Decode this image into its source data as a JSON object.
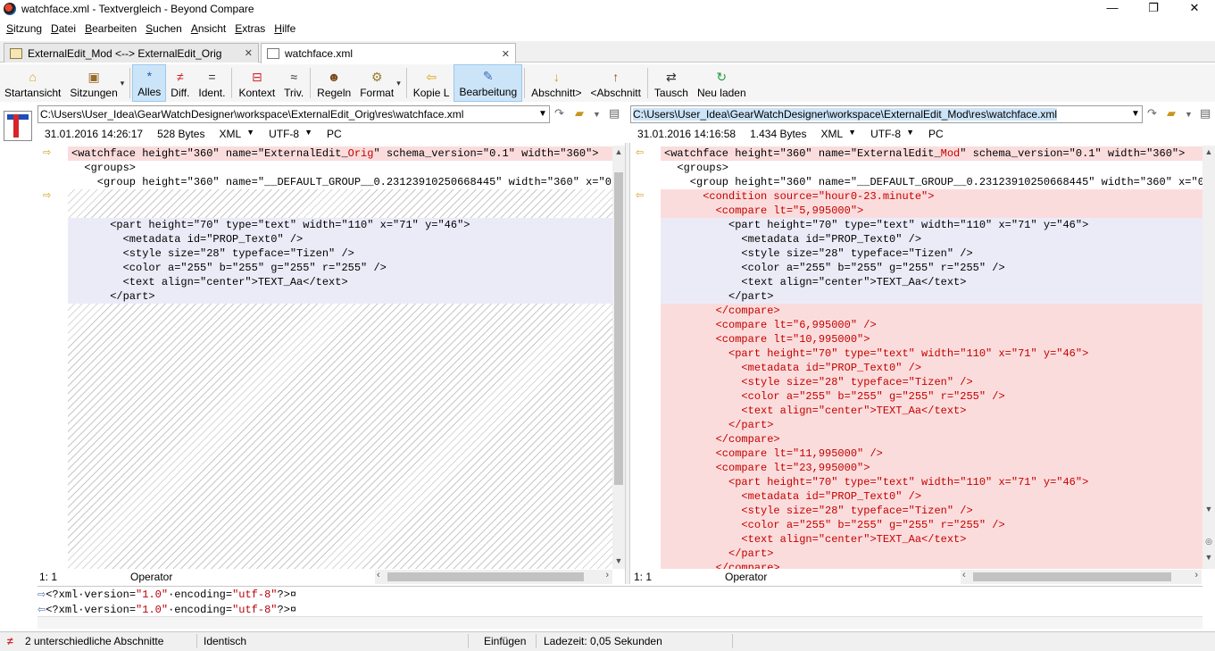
{
  "window": {
    "title": "watchface.xml - Textvergleich - Beyond Compare",
    "controls": [
      "—",
      "❐",
      "✕"
    ]
  },
  "menu": [
    "Sitzung",
    "Datei",
    "Bearbeiten",
    "Suchen",
    "Ansicht",
    "Extras",
    "Hilfe"
  ],
  "tabs": [
    {
      "label": "ExternalEdit_Mod <--> ExternalEdit_Orig",
      "close": "✕"
    },
    {
      "label": "watchface.xml",
      "close": "✕"
    }
  ],
  "toolbar": {
    "startansicht": "Startansicht",
    "sitzungen": "Sitzungen",
    "alles": "Alles",
    "diff": "Diff.",
    "ident": "Ident.",
    "kontext": "Kontext",
    "triv": "Triv.",
    "regeln": "Regeln",
    "format": "Format",
    "kopie_l": "Kopie L",
    "bearbeitung": "Bearbeitung",
    "abschnitt_next": "Abschnitt>",
    "abschnitt_prev": "<Abschnitt",
    "tausch": "Tausch",
    "neu_laden": "Neu laden",
    "dropdown": "▾"
  },
  "left": {
    "path": "C:\\Users\\User_Idea\\GearWatchDesigner\\workspace\\ExternalEdit_Orig\\res\\watchface.xml",
    "date": "31.01.2016 14:26:17",
    "size": "528 Bytes",
    "format": "XML",
    "encoding": "UTF-8",
    "lineend": "PC",
    "pos": "1: 1",
    "mode": "Operator",
    "lines": {
      "l1_pre": "<watchface height=\"360\" name=\"ExternalEdit_",
      "l1_hl": "Orig",
      "l1_post": "\" schema_version=\"0.1\" width=\"360\">",
      "l2": "  <groups>",
      "l3": "    <group height=\"360\" name=\"__DEFAULT_GROUP__0.23123910250668445\" width=\"360\" x=\"0\" y",
      "l6": "      <part height=\"70\" type=\"text\" width=\"110\" x=\"71\" y=\"46\">",
      "l7": "        <metadata id=\"PROP_Text0\" />",
      "l8": "        <style size=\"28\" typeface=\"Tizen\" />",
      "l9": "        <color a=\"255\" b=\"255\" g=\"255\" r=\"255\" />",
      "l10": "        <text align=\"center\">TEXT_Aa</text>",
      "l11": "      </part>"
    }
  },
  "right": {
    "path": "C:\\Users\\User_Idea\\GearWatchDesigner\\workspace\\ExternalEdit_Mod\\res\\watchface.xml",
    "date": "31.01.2016 14:16:58",
    "size": "1.434 Bytes",
    "format": "XML",
    "encoding": "UTF-8",
    "lineend": "PC",
    "pos": "1: 1",
    "mode": "Operator",
    "lines": {
      "l1_pre": "<watchface height=\"360\" name=\"ExternalEdit_",
      "l1_hl": "Mod",
      "l1_post": "\" schema_version=\"0.1\" width=\"360\">",
      "l2": "  <groups>",
      "l3": "    <group height=\"360\" name=\"__DEFAULT_GROUP__0.23123910250668445\" width=\"360\" x=\"0\" y",
      "l4": "      <condition source=\"hour0-23.minute\">",
      "l5": "        <compare lt=\"5,995000\">",
      "l6": "          <part height=\"70\" type=\"text\" width=\"110\" x=\"71\" y=\"46\">",
      "l7": "            <metadata id=\"PROP_Text0\" />",
      "l8": "            <style size=\"28\" typeface=\"Tizen\" />",
      "l9": "            <color a=\"255\" b=\"255\" g=\"255\" r=\"255\" />",
      "l10": "            <text align=\"center\">TEXT_Aa</text>",
      "l11": "          </part>",
      "l12": "        </compare>",
      "l13": "        <compare lt=\"6,995000\" />",
      "l14": "        <compare lt=\"10,995000\">",
      "l15": "          <part height=\"70\" type=\"text\" width=\"110\" x=\"71\" y=\"46\">",
      "l16": "            <metadata id=\"PROP_Text0\" />",
      "l17": "            <style size=\"28\" typeface=\"Tizen\" />",
      "l18": "            <color a=\"255\" b=\"255\" g=\"255\" r=\"255\" />",
      "l19": "            <text align=\"center\">TEXT_Aa</text>",
      "l20": "          </part>",
      "l21": "        </compare>",
      "l22": "        <compare lt=\"11,995000\" />",
      "l23": "        <compare lt=\"23,995000\">",
      "l24": "          <part height=\"70\" type=\"text\" width=\"110\" x=\"71\" y=\"46\">",
      "l25": "            <metadata id=\"PROP_Text0\" />",
      "l26": "            <style size=\"28\" typeface=\"Tizen\" />",
      "l27": "            <color a=\"255\" b=\"255\" g=\"255\" r=\"255\" />",
      "l28": "            <text align=\"center\">TEXT_Aa</text>",
      "l29": "          </part>",
      "l30": "        </compare>"
    }
  },
  "linecompare": {
    "prefix": "<?xml·version=",
    "v1": "\"1.0\"",
    "mid": "·encoding=",
    "v2": "\"utf-8\"",
    "suffix": "?>¤"
  },
  "status": {
    "diff_count": "2 unterschiedliche Abschnitte",
    "identical": "Identisch",
    "insert_mode": "Einfügen",
    "load_time": "Ladezeit: 0,05 Sekunden"
  },
  "colors": {
    "diff_bg": "#fbdcdc",
    "diff_text": "#c40000",
    "moved_bg": "#ebebf8",
    "selected_tool": "#cce4f7"
  }
}
